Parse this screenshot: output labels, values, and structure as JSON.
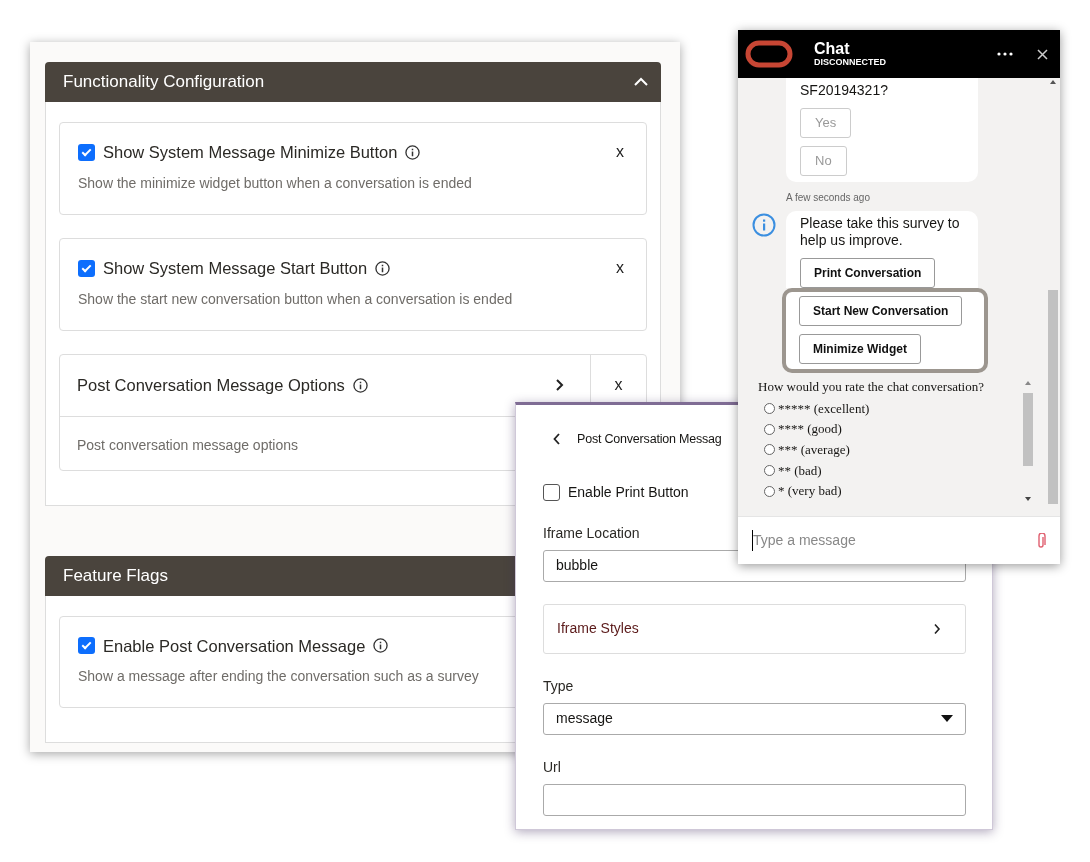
{
  "config_panel": {
    "sections": [
      {
        "title": "Functionality Configuration",
        "expanded": true,
        "items": [
          {
            "kind": "checkbox",
            "label": "Show System Message Minimize Button",
            "checked": true,
            "description": "Show the minimize widget button when a conversation is ended",
            "remove": "x"
          },
          {
            "kind": "checkbox",
            "label": "Show System Message Start Button",
            "checked": true,
            "description": "Show the start new conversation button when a conversation is ended",
            "remove": "x"
          },
          {
            "kind": "group",
            "label": "Post Conversation Message Options",
            "description": "Post conversation message options",
            "remove": "x"
          }
        ]
      },
      {
        "title": "Feature Flags",
        "items": [
          {
            "kind": "checkbox",
            "label": "Enable Post Conversation Message",
            "checked": true,
            "description": "Show a message after ending the conversation such as a survey"
          }
        ]
      }
    ]
  },
  "settings_panel": {
    "title": "Post Conversation Messag",
    "fields": [
      {
        "kind": "checkbox",
        "label": "Enable Print Button",
        "checked": false
      },
      {
        "kind": "text",
        "label": "Iframe Location",
        "value": "bubble"
      },
      {
        "kind": "link",
        "label": "Iframe Styles"
      },
      {
        "kind": "select",
        "label": "Type",
        "value": "message"
      },
      {
        "kind": "text",
        "label": "Url"
      }
    ]
  },
  "chat": {
    "title": "Chat",
    "status": "DISCONNECTED",
    "messages": [
      {
        "text": "SF20194321?",
        "actions": [
          {
            "label": "Yes",
            "disabled": true
          },
          {
            "label": "No",
            "disabled": true
          }
        ]
      },
      {
        "kind": "timestamp",
        "text": "A few seconds ago"
      },
      {
        "text": "Please take this survey to help us improve.",
        "info": true,
        "actions": [
          {
            "label": "Print Conversation",
            "disabled": false
          }
        ],
        "highlighted_actions": [
          {
            "label": "Start New Conversation",
            "disabled": false
          },
          {
            "label": "Minimize Widget",
            "disabled": false
          }
        ]
      }
    ],
    "survey": {
      "question": "How would you rate the chat conversation?",
      "options": [
        {
          "label": "***** (excellent)",
          "selected": false
        },
        {
          "label": "**** (good)",
          "selected": false
        },
        {
          "label": "*** (average)",
          "selected": false
        },
        {
          "label": "** (bad)",
          "selected": false
        },
        {
          "label": "* (very bad)",
          "selected": false
        }
      ]
    },
    "input": {
      "placeholder": "Type a message"
    }
  }
}
